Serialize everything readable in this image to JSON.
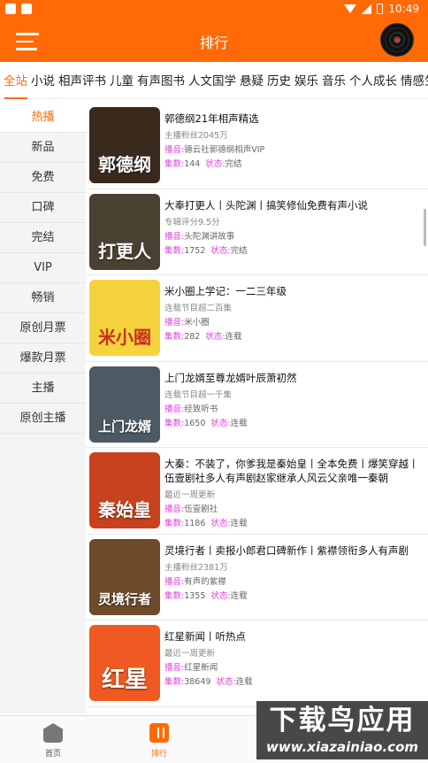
{
  "status_bar": {
    "time": "10:49"
  },
  "app_bar": {
    "title": "排行",
    "menu_icon": "hamburger-menu-icon",
    "player_icon": "vinyl-disc-icon"
  },
  "category_tabs": [
    "全站",
    "小说",
    "相声评书",
    "儿童",
    "有声图书",
    "人文国学",
    "悬疑",
    "历史",
    "娱乐",
    "音乐",
    "个人成长",
    "情感生"
  ],
  "active_category": "全站",
  "sidebar": [
    "热播",
    "新品",
    "免费",
    "口碑",
    "完结",
    "VIP",
    "畅销",
    "原创月票",
    "爆款月票",
    "主播",
    "原创主播"
  ],
  "active_sidebar": "热播",
  "labels": {
    "host": "播音:",
    "count": "集数:",
    "status": "状态:"
  },
  "books": [
    {
      "title": "郭德纲21年相声精选",
      "sub": "主播粉丝2045万",
      "host": "德云社郭德纲相声VIP",
      "count": "144",
      "status": "完结",
      "cover_text": "郭德纲",
      "cover_bg": "#3a2a1e"
    },
    {
      "title": "大奉打更人丨头陀渊丨搞笑修仙免费有声小说",
      "sub": "专辑评分9.5分",
      "host": "头陀渊讲故事",
      "count": "1752",
      "status": "完结",
      "cover_text": "打更人",
      "cover_bg": "#4b4133"
    },
    {
      "title": "米小圈上学记：一二三年级",
      "sub": "连载节目超二百集",
      "host": "米小圈",
      "count": "282",
      "status": "连载",
      "cover_text": "米小圈",
      "cover_bg": "#f4d33c"
    },
    {
      "title": "上门龙婿至尊龙婿叶辰萧初然",
      "sub": "连载节目超一千集",
      "host": "经致听书",
      "count": "1650",
      "status": "连载",
      "cover_text": "上门龙婿",
      "cover_bg": "#4e5a63"
    },
    {
      "title": "大秦：不装了，你爹我是秦始皇丨全本免费丨爆笑穿越丨伍壹剧社多人有声剧赵家继承人风云父亲唯一秦朝",
      "sub": "最近一周更新",
      "host": "伍壹剧社",
      "count": "1186",
      "status": "连载",
      "cover_text": "秦始皇",
      "cover_bg": "#c8421e"
    },
    {
      "title": "灵境行者丨卖报小郎君口碑新作丨紫襟领衔多人有声剧",
      "sub": "主播粉丝2381万",
      "host": "有声的紫襟",
      "count": "1355",
      "status": "连载",
      "cover_text": "灵境行者",
      "cover_bg": "#6e4a2a"
    },
    {
      "title": "红星新闻丨听热点",
      "sub": "最近一周更新",
      "host": "红星新闻",
      "count": "38649",
      "status": "连载",
      "cover_text": "红星",
      "cover_bg": "#f05a22"
    }
  ],
  "bottom_nav": [
    {
      "label": "首页",
      "icon": "home-icon"
    },
    {
      "label": "排行",
      "icon": "ranking-icon"
    }
  ],
  "watermark": {
    "title": "下载鸟应用",
    "url": "www.xiazainiao.com"
  },
  "colors": {
    "accent": "#ff6a07",
    "meta_key": "#e040e0"
  }
}
